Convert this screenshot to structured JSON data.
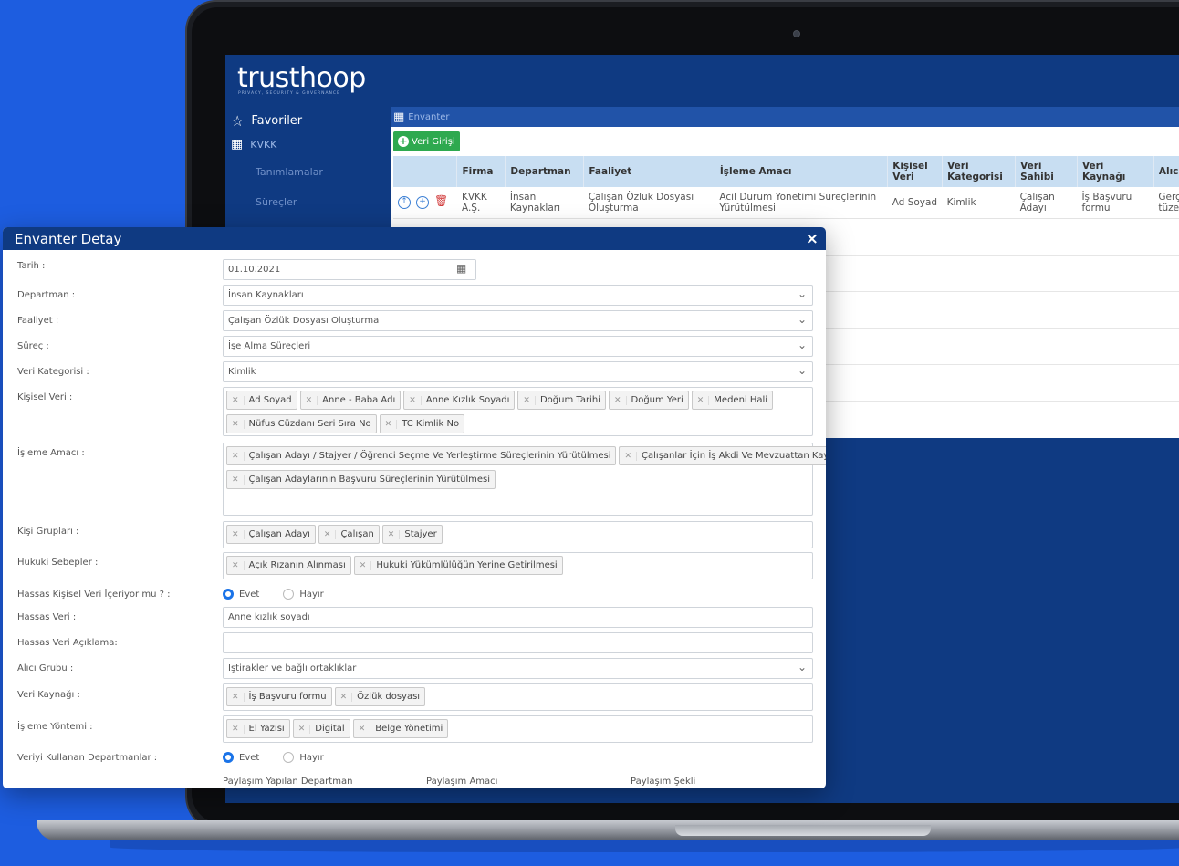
{
  "app": {
    "logo": "trusthoop",
    "tagline": "PRIVACY, SECURITY & GOVERNANCE"
  },
  "sidebar": {
    "items": [
      {
        "label": "Favoriler",
        "icon": "star-icon"
      },
      {
        "label": "KVKK",
        "icon": "grid-icon"
      }
    ],
    "subitems": [
      "Tanımlamalar",
      "Süreçler"
    ]
  },
  "main": {
    "breadcrumb": "Envanter",
    "new_button": "Veri Girişi",
    "table": {
      "headers": [
        "",
        "Firma",
        "Departman",
        "Faaliyet",
        "İşleme Amacı",
        "Kişisel Veri",
        "Veri Kategorisi",
        "Veri Sahibi",
        "Veri Kaynağı",
        "Alıcı"
      ],
      "row": {
        "firma": "KVKK A.Ş.",
        "departman": "İnsan Kaynakları",
        "faaliyet": "Çalışan Özlük Dosyası Oluşturma",
        "isleme_amaci": "Acil Durum Yönetimi Süreçlerinin Yürütülmesi",
        "kisisel_veri": "Ad Soyad",
        "veri_kategorisi": "Kimlik",
        "veri_sahibi": "Çalışan Adayı",
        "veri_kaynagi": "İş Başvuru formu",
        "alici": "Gerç tüze"
      }
    }
  },
  "modal": {
    "title": "Envanter Detay",
    "close": "×",
    "fields": {
      "tarih": {
        "label": "Tarih :",
        "value": "01.10.2021"
      },
      "departman": {
        "label": "Departman :",
        "value": "İnsan Kaynakları"
      },
      "faaliyet": {
        "label": "Faaliyet :",
        "value": "Çalışan Özlük Dosyası Oluşturma"
      },
      "surec": {
        "label": "Süreç :",
        "value": "İşe Alma Süreçleri"
      },
      "veri_kategorisi": {
        "label": "Veri Kategorisi :",
        "value": "Kimlik"
      },
      "kisisel_veri": {
        "label": "Kişisel Veri :",
        "tags": [
          "Ad Soyad",
          "Anne - Baba Adı",
          "Anne Kızlık Soyadı",
          "Doğum Tarihi",
          "Doğum Yeri",
          "Medeni Hali",
          "Nüfus Cüzdanı Seri Sıra No",
          "TC Kimlik No"
        ]
      },
      "isleme_amaci": {
        "label": "İşleme Amacı :",
        "tags": [
          "Çalışan Adayı / Stajyer / Öğrenci Seçme Ve Yerleştirme Süreçlerinin Yürütülmesi",
          "Çalışan Adaylarının Başvuru Süreçlerinin Yürütülmesi",
          "Çalışanlar İçin İş Akdi Ve Mevzuattan Kaynaklı Yükümlülüklerin Yerine Getirilmesi"
        ]
      },
      "kisi_gruplari": {
        "label": "Kişi Grupları :",
        "tags": [
          "Çalışan Adayı",
          "Çalışan",
          "Stajyer"
        ]
      },
      "hukuki_sebepler": {
        "label": "Hukuki Sebepler :",
        "tags": [
          "Açık Rızanın Alınması",
          "Hukuki Yükümlülüğün Yerine Getirilmesi"
        ]
      },
      "hassas_mi": {
        "label": "Hassas Kişisel Veri İçeriyor mu ? :",
        "yes": "Evet",
        "no": "Hayır"
      },
      "hassas_veri": {
        "label": "Hassas Veri :",
        "value": "Anne kızlık soyadı"
      },
      "hassas_aciklama": {
        "label": "Hassas Veri Açıklama:",
        "value": ""
      },
      "alici_grubu": {
        "label": "Alıcı Grubu :",
        "value": "İştirakler ve bağlı ortaklıklar"
      },
      "veri_kaynagi": {
        "label": "Veri Kaynağı :",
        "tags": [
          "İş Başvuru formu",
          "Özlük dosyası"
        ]
      },
      "isleme_yontemi": {
        "label": "İşleme Yöntemi :",
        "tags": [
          "El Yazısı",
          "Digital",
          "Belge Yönetimi"
        ]
      },
      "kullanan_dept": {
        "label": "Veriyi Kullanan Departmanlar :",
        "yes": "Evet",
        "no": "Hayır"
      }
    },
    "share_headers": [
      "Paylaşım Yapılan Departman",
      "Paylaşım Amacı",
      "Paylaşım Şekli"
    ]
  },
  "colors": {
    "background": "#1d5de0",
    "navy": "#0f3a82",
    "green_button": "#2ea94f",
    "table_header": "#c8def2",
    "radio_selected": "#1a73e8"
  }
}
